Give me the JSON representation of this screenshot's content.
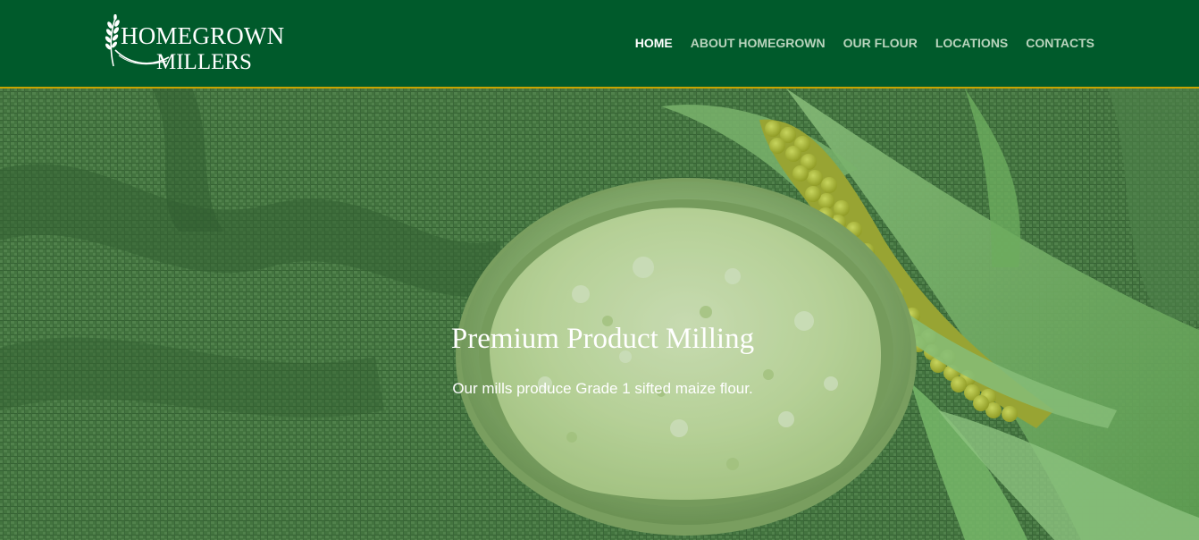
{
  "brand": {
    "line1": "HOMEGROWN",
    "line2": "MILLERS"
  },
  "nav": {
    "items": [
      {
        "label": "HOME",
        "active": true
      },
      {
        "label": "ABOUT HOMEGROWN",
        "active": false
      },
      {
        "label": "OUR FLOUR",
        "active": false
      },
      {
        "label": "LOCATIONS",
        "active": false
      },
      {
        "label": "CONTACTS",
        "active": false
      }
    ]
  },
  "hero": {
    "title": "Premium Product Milling",
    "subtitle": "Our mills produce Grade 1 sifted maize flour."
  },
  "colors": {
    "header_bg": "#005a2b",
    "header_border": "#c9a400",
    "nav_active": "#ffffff",
    "nav_inactive": "#b9d4bd",
    "hero_tint": "#3f6a3a"
  }
}
